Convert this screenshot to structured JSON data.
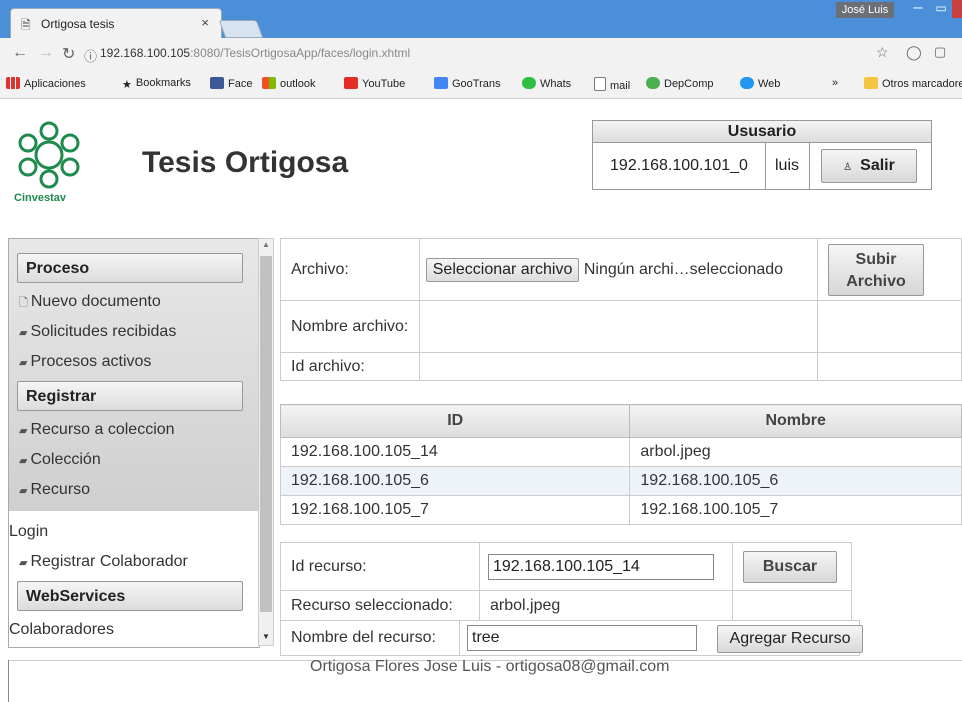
{
  "browser": {
    "tab_title": "Ortigosa tesis",
    "tab_close": "×",
    "user_badge": "José Luis",
    "url_host": "192.168.100.105",
    "url_rest": ":8080/TesisOrtigosaApp/faces/login.xhtml",
    "bookmarks": [
      "Aplicaciones",
      "Bookmarks",
      "Face",
      "outlook",
      "YouTube",
      "GooTrans",
      "Whats",
      "mail",
      "DepComp",
      "Web"
    ],
    "bookmarks_overflow": "»",
    "other_bookmarks": "Otros marcadores"
  },
  "header": {
    "logo_text": "Cinvestav",
    "title": "Tesis Ortigosa",
    "user_panel_title": "Ususario",
    "session_id": "192.168.100.101_0",
    "username": "luis",
    "logout_label": "Salir"
  },
  "sidebar": {
    "sections": [
      {
        "title": "Proceso",
        "items": [
          "Nuevo documento",
          "Solicitudes recibidas",
          "Procesos activos"
        ]
      },
      {
        "title": "Registrar",
        "items": [
          "Recurso a coleccion",
          "Colección",
          "Recurso"
        ]
      },
      {
        "title": "",
        "items": [
          "Login",
          "Registrar Colaborador"
        ]
      },
      {
        "title": "WebServices",
        "items": [
          "Colaboradores"
        ]
      }
    ]
  },
  "upload": {
    "file_label": "Archivo:",
    "choose_button": "Seleccionar archivo",
    "no_file_text": "Ningún archi…seleccionado",
    "upload_button": "Subir Archivo",
    "name_label": "Nombre archivo:",
    "id_label": "Id archivo:"
  },
  "results": {
    "columns": [
      "ID",
      "Nombre"
    ],
    "rows": [
      [
        "192.168.100.105_14",
        "arbol.jpeg"
      ],
      [
        "192.168.100.105_6",
        "192.168.100.105_6"
      ],
      [
        "192.168.100.105_7",
        "192.168.100.105_7"
      ]
    ]
  },
  "search": {
    "id_label": "Id recurso:",
    "id_value": "192.168.100.105_14",
    "search_button": "Buscar",
    "selected_label": "Recurso seleccionado:",
    "selected_value": "arbol.jpeg",
    "name_label": "Nombre del recurso:",
    "name_value": "tree",
    "add_button": "Agregar Recurso"
  },
  "footer": "Ortigosa Flores Jose Luis - ortigosa08@gmail.com",
  "colors": {
    "titlebar": "#4a8fd8",
    "logo_green": "#1e8a4b"
  }
}
